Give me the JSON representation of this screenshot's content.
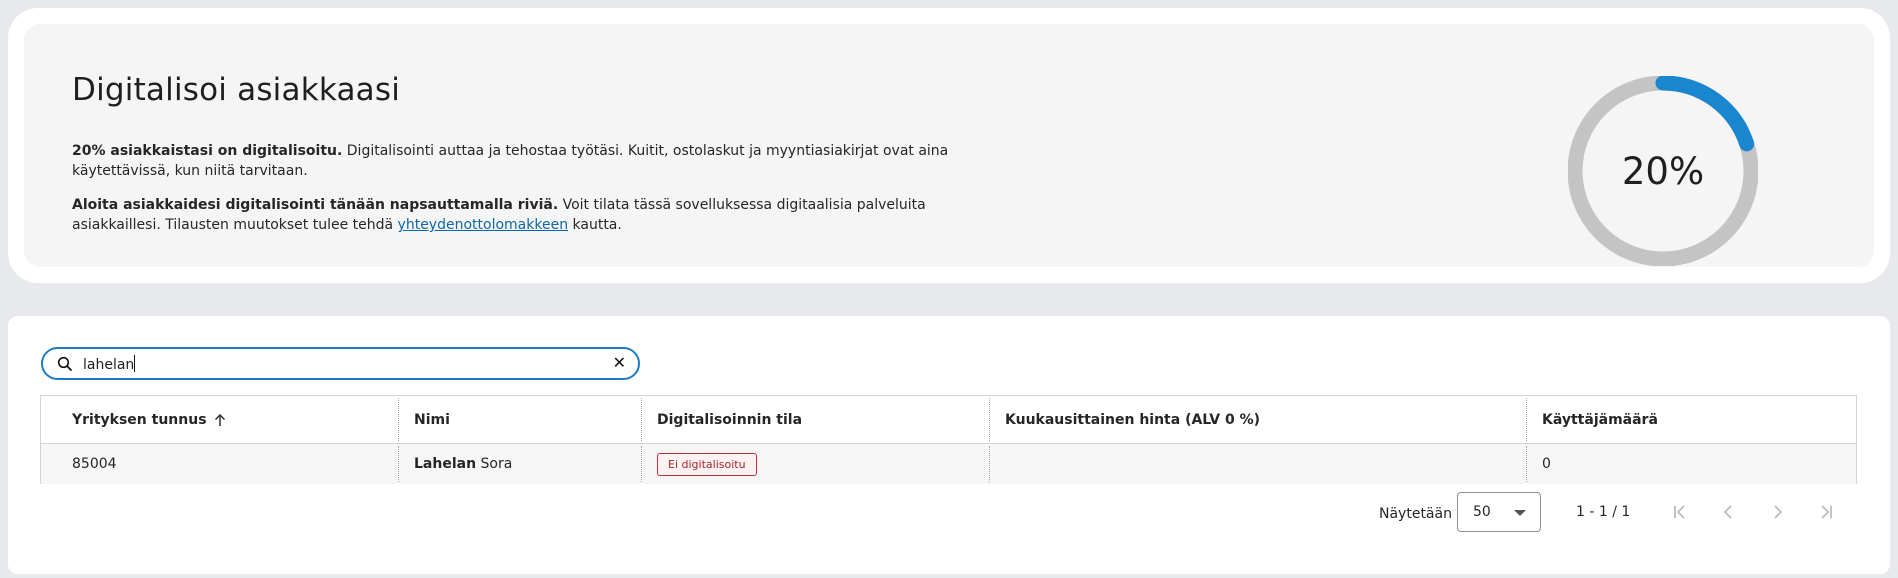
{
  "hero": {
    "title": "Digitalisoi asiakkaasi",
    "p1_bold": "20% asiakkaistasi on digitalisoitu.",
    "p1_rest": " Digitalisointi auttaa ja tehostaa työtäsi. Kuitit, ostolaskut ja myyntiasiakirjat ovat aina käytettävissä, kun niitä tarvitaan.",
    "p2_bold": "Aloita asiakkaidesi digitalisointi tänään napsauttamalla riviä.",
    "p2_rest": " Voit tilata tässä sovelluksessa digitaalisia palveluita asiakkaillesi. Tilausten muutokset tulee tehdä ",
    "p2_link": "yhteydenottolomakkeen",
    "p2_end": " kautta.",
    "progress_label": "20%",
    "progress_fraction": 0.2,
    "progress_color": "#1a86d0",
    "track_color": "#c4c4c4"
  },
  "search": {
    "value": "lahelan",
    "icon": "search-icon",
    "clear_icon": "close-icon",
    "clear_glyph": "✕"
  },
  "table": {
    "headers": {
      "business_id": "Yrityksen tunnus",
      "name": "Nimi",
      "status": "Digitalisoinnin tila",
      "price": "Kuukausittainen hinta (ALV 0 %)",
      "users": "Käyttäjämäärä"
    },
    "sort_icon": "arrow-up-icon",
    "rows": [
      {
        "business_id": "85004",
        "name_match": "Lahelan",
        "name_rest": " Sora",
        "status": "Ei digitalisoitu",
        "price": "",
        "users": "0"
      }
    ]
  },
  "pager": {
    "label": "Näytetään",
    "page_size": "50",
    "range": "1 - 1 / 1",
    "icons": [
      "first-page-icon",
      "prev-page-icon",
      "next-page-icon",
      "last-page-icon"
    ]
  }
}
